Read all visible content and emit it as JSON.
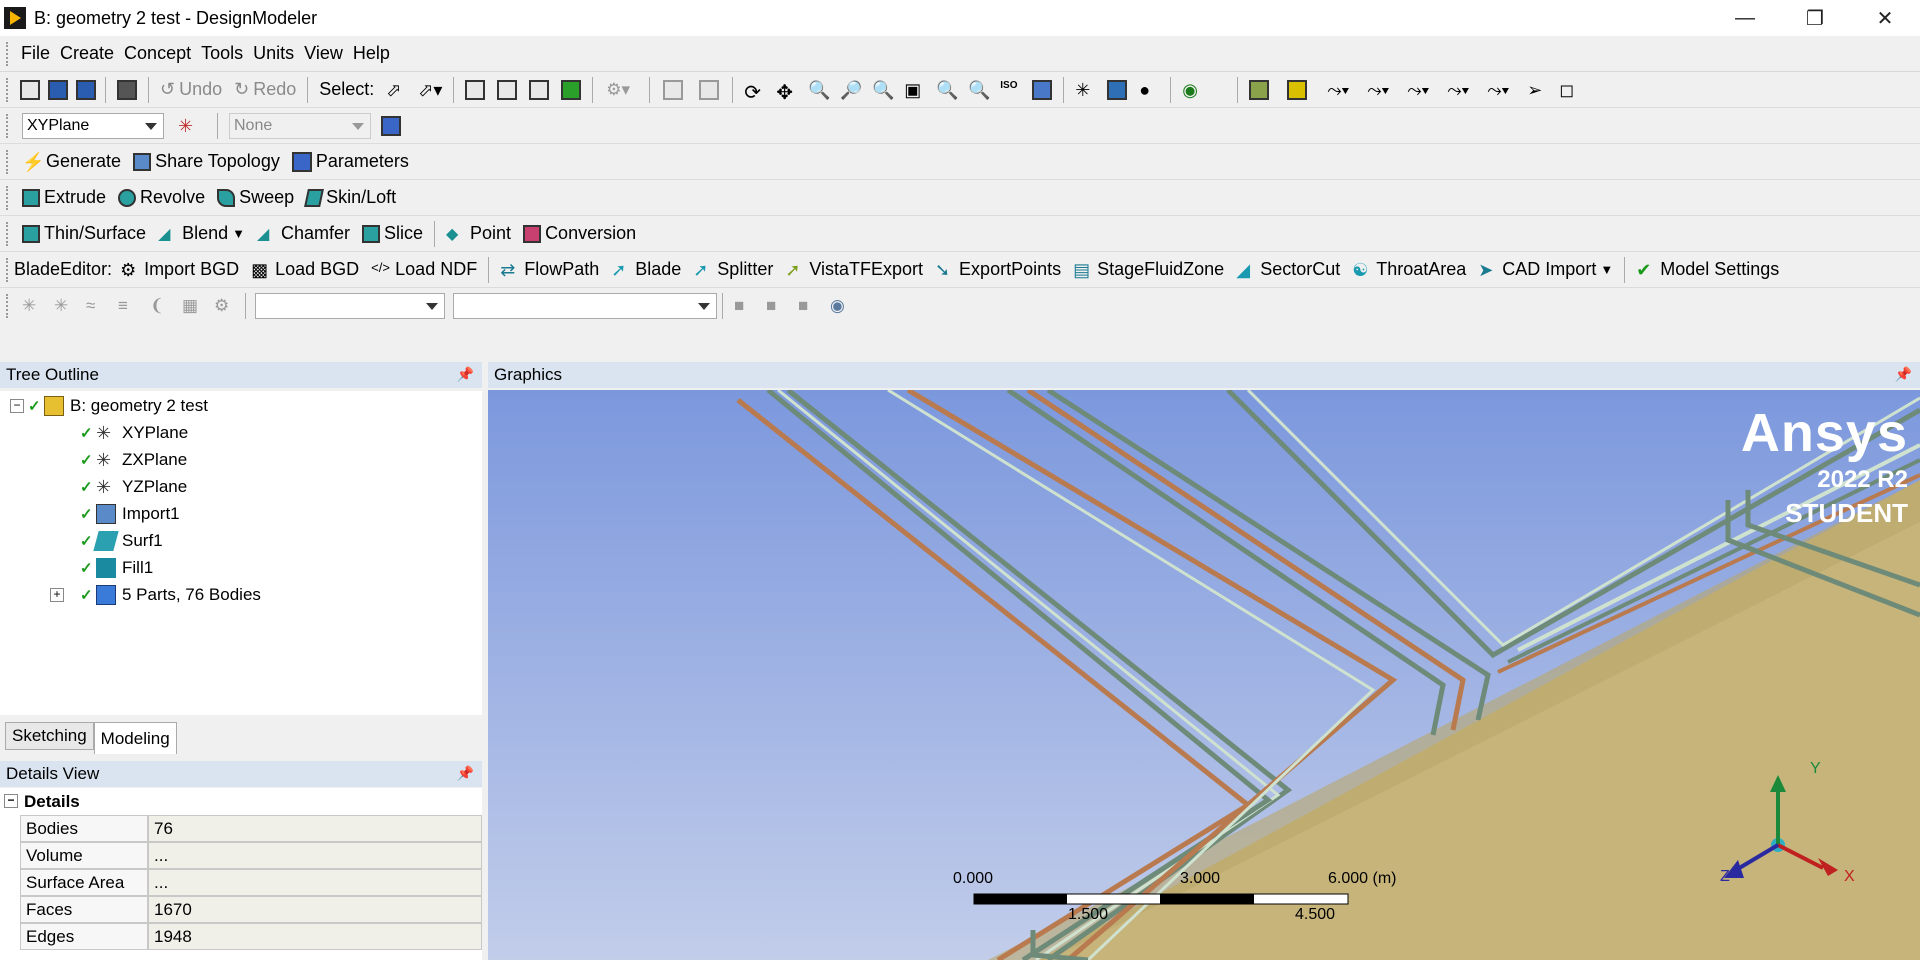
{
  "window": {
    "title": "B: geometry 2 test - DesignModeler"
  },
  "menu": [
    "File",
    "Create",
    "Concept",
    "Tools",
    "Units",
    "View",
    "Help"
  ],
  "toolbar1": {
    "undo_label": "Undo",
    "redo_label": "Redo",
    "select_label": "Select:"
  },
  "toolbar2": {
    "plane_value": "XYPlane",
    "sketch_value": "None"
  },
  "toolbar3": {
    "generate": "Generate",
    "share_topology": "Share Topology",
    "parameters": "Parameters"
  },
  "toolbar4": {
    "extrude": "Extrude",
    "revolve": "Revolve",
    "sweep": "Sweep",
    "skin_loft": "Skin/Loft"
  },
  "toolbar5": {
    "thin_surface": "Thin/Surface",
    "blend": "Blend",
    "chamfer": "Chamfer",
    "slice": "Slice",
    "point": "Point",
    "conversion": "Conversion"
  },
  "toolbar6": {
    "blade_editor": "BladeEditor:",
    "import_bgd": "Import BGD",
    "load_bgd": "Load BGD",
    "load_ndf": "Load NDF",
    "flowpath": "FlowPath",
    "blade": "Blade",
    "splitter": "Splitter",
    "vistatf": "VistaTFExport",
    "exportpoints": "ExportPoints",
    "stagefluid": "StageFluidZone",
    "sectorcut": "SectorCut",
    "throatarea": "ThroatArea",
    "cad_import": "CAD Import",
    "model_settings": "Model Settings"
  },
  "tree": {
    "header": "Tree Outline",
    "root": "B: geometry 2 test",
    "items": [
      "XYPlane",
      "ZXPlane",
      "YZPlane",
      "Import1",
      "Surf1",
      "Fill1",
      "5 Parts, 76 Bodies"
    ]
  },
  "tabs": [
    "Sketching",
    "Modeling"
  ],
  "details": {
    "header": "Details View",
    "group": "Details",
    "rows": [
      {
        "key": "Bodies",
        "value": "76"
      },
      {
        "key": "Volume",
        "value": "..."
      },
      {
        "key": "Surface Area",
        "value": "..."
      },
      {
        "key": "Faces",
        "value": "1670"
      },
      {
        "key": "Edges",
        "value": "1948"
      }
    ]
  },
  "graphics": {
    "header": "Graphics",
    "brand": "Ansys",
    "version": "2022 R2",
    "edition": "STUDENT",
    "scale_top": [
      "0.000",
      "3.000",
      "6.000 (m)"
    ],
    "scale_bottom": [
      "1.500",
      "4.500"
    ],
    "axes": {
      "y": "Y",
      "z": "Z",
      "x": "X"
    }
  },
  "colors": {
    "viewport_top": "#7c98dd",
    "ground": "#c7b47a",
    "pipe_copper": "#b87a4e",
    "pipe_gray": "#6e8a78",
    "pipe_light": "#cfe2cf"
  }
}
